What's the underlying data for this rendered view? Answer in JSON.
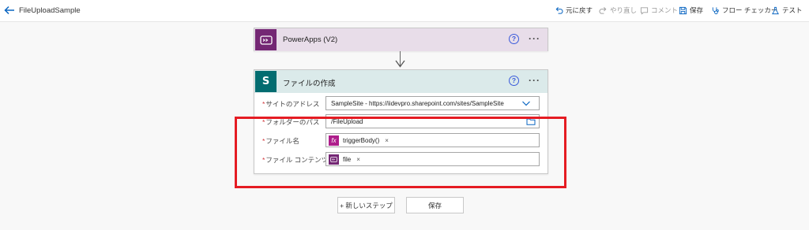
{
  "app": {
    "title": "FileUploadSample"
  },
  "toolbar": {
    "undo": "元に戻す",
    "redo": "やり直し",
    "comment": "コメント",
    "save": "保存",
    "flow_checker": "フロー チェッカー",
    "test": "テスト"
  },
  "powerapps_card": {
    "title": "PowerApps (V2)",
    "help": "?",
    "more": "···"
  },
  "sharepoint_card": {
    "title": "ファイルの作成",
    "icon_letter": "S",
    "help": "?",
    "more": "···",
    "fields": {
      "site": {
        "label": "サイトのアドレス",
        "value": "SampleSite - https://iidevpro.sharepoint.com/sites/SampleSite"
      },
      "folder": {
        "label": "フォルダーのパス",
        "value": "/FileUpload"
      },
      "filename": {
        "label": "ファイル名",
        "token": "triggerBody()",
        "token_icon": "fx"
      },
      "content": {
        "label": "ファイル コンテンツ",
        "token": "file"
      }
    },
    "required_mark": "*",
    "remove_mark": "×"
  },
  "actions": {
    "new_step": "+ 新しいステップ",
    "save": "保存"
  },
  "colors": {
    "powerapps": "#742774",
    "sharepoint": "#036c70",
    "highlight": "#e51c23",
    "accent": "#0a66c2",
    "expression": "#ae1e8b"
  }
}
